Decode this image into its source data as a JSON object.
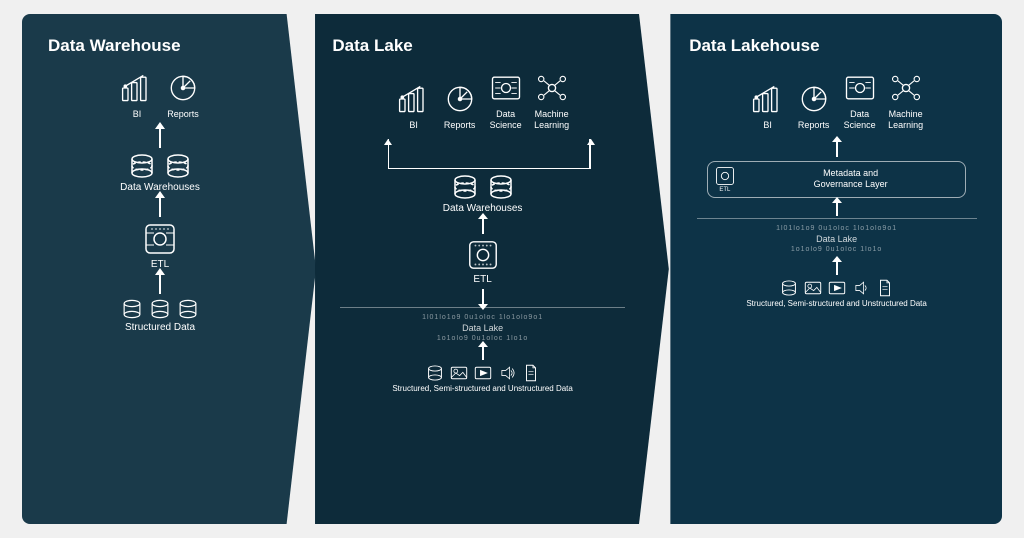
{
  "panels": [
    {
      "id": "warehouse",
      "title": "Data Warehouse",
      "top_icons": [
        {
          "label": "BI",
          "icon": "chart"
        },
        {
          "label": "Reports",
          "icon": "report"
        }
      ],
      "layer1_label": "Data Warehouses",
      "etl_label": "ETL",
      "source_label": "Structured Data"
    },
    {
      "id": "lake",
      "title": "Data Lake",
      "top_icons": [
        {
          "label": "BI",
          "icon": "chart"
        },
        {
          "label": "Reports",
          "icon": "report"
        },
        {
          "label": "Data Science",
          "icon": "datascience"
        },
        {
          "label": "Machine Learning",
          "icon": "ml"
        }
      ],
      "layer1_label": "Data Warehouses",
      "etl_label": "ETL",
      "datalake_label": "Data Lake",
      "source_label": "Structured, Semi-structured and Unstructured Data",
      "binary": "1l01lo1o9ou1oloc1lo1olo9o1"
    },
    {
      "id": "lakehouse",
      "title": "Data Lakehouse",
      "top_icons": [
        {
          "label": "BI",
          "icon": "chart"
        },
        {
          "label": "Reports",
          "icon": "report"
        },
        {
          "label": "Data Science",
          "icon": "datascience"
        },
        {
          "label": "Machine Learning",
          "icon": "ml"
        }
      ],
      "metadata_label": "Metadata and\nGovernance Layer",
      "etl_label": "ETL",
      "datalake_label": "Data Lake",
      "source_label": "Structured, Semi-structured\nand Unstructured Data",
      "binary": "1l01lo1o9ou1oloc1lo1olo9o1"
    }
  ]
}
